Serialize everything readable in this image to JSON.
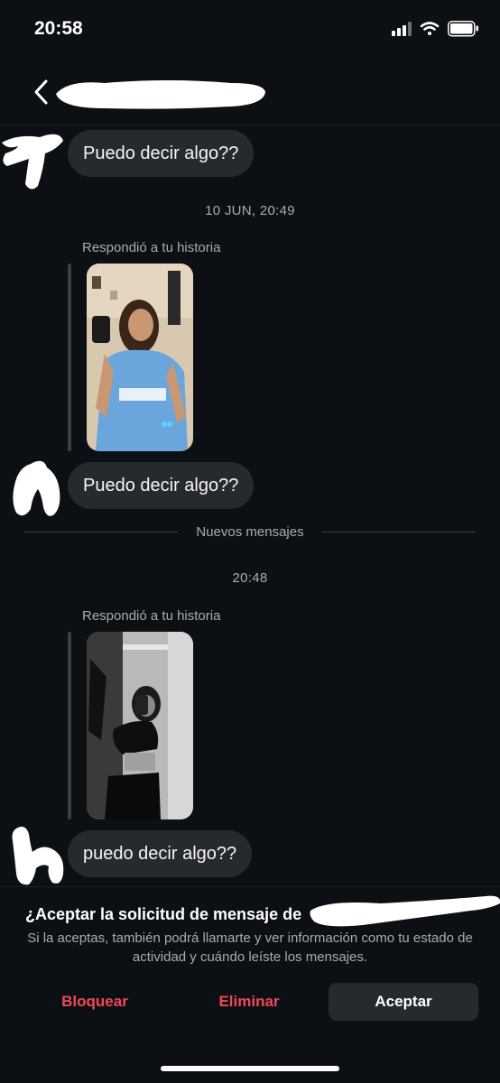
{
  "status_bar": {
    "time": "20:58",
    "icons": [
      "signal-icon",
      "wifi-icon",
      "battery-icon"
    ]
  },
  "header": {
    "back_icon": "chevron-left-icon"
  },
  "messages": [
    {
      "text": "Puedo decir algo??"
    },
    {
      "timestamp": "10 JUN, 20:49"
    },
    {
      "reply_label": "Respondió a tu historia"
    },
    {
      "text": "Puedo decir algo??"
    },
    {
      "divider": "Nuevos mensajes"
    },
    {
      "timestamp": "20:48"
    },
    {
      "reply_label": "Respondió a tu historia"
    },
    {
      "text": "puedo decir algo??"
    }
  ],
  "request": {
    "title": "¿Aceptar la solicitud de mensaje de",
    "description": "Si la aceptas, también podrá llamarte y ver información como tu estado de actividad y cuándo leíste los mensajes.",
    "block_label": "Bloquear",
    "delete_label": "Eliminar",
    "accept_label": "Aceptar"
  },
  "colors": {
    "background": "#0c1014",
    "bubble": "#262a2f",
    "danger": "#ed4956",
    "secondary_text": "#a8acb3"
  }
}
